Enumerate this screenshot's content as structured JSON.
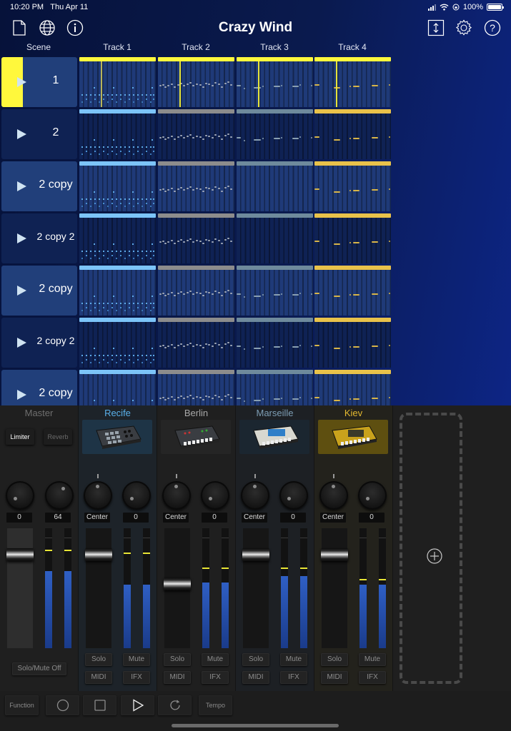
{
  "status_bar": {
    "time": "10:20 PM",
    "date": "Thu Apr 11",
    "battery": "100%"
  },
  "toolbar": {
    "title": "Crazy Wind",
    "left_icons": [
      "document-icon",
      "globe-icon",
      "info-icon"
    ],
    "right_icons": [
      "resize-vertical-icon",
      "gear-icon",
      "help-icon"
    ]
  },
  "grid": {
    "scene_header": "Scene",
    "tracks": [
      {
        "name": "Track 1",
        "color": "#7cc4f8"
      },
      {
        "name": "Track 2",
        "color": "#8c8c8c"
      },
      {
        "name": "Track 3",
        "color": "#6e8a9c"
      },
      {
        "name": "Track 4",
        "color": "#e9c24a"
      }
    ],
    "playing_color": "#fff83c",
    "scenes": [
      {
        "name": "1",
        "selected": true,
        "style": "light",
        "playing": true,
        "empty": []
      },
      {
        "name": "2",
        "selected": false,
        "style": "dark",
        "playing": false,
        "empty": []
      },
      {
        "name": "2 copy",
        "selected": false,
        "style": "light",
        "playing": false,
        "empty": [
          2
        ]
      },
      {
        "name": "2 copy 2",
        "selected": false,
        "style": "dark",
        "playing": false,
        "empty": [
          2
        ]
      },
      {
        "name": "2 copy",
        "selected": false,
        "style": "light",
        "playing": false,
        "empty": []
      },
      {
        "name": "2 copy 2",
        "selected": false,
        "style": "dark",
        "playing": false,
        "empty": []
      },
      {
        "name": "2 copy",
        "selected": false,
        "style": "light",
        "playing": false,
        "empty": []
      }
    ],
    "playhead_position": 0.28
  },
  "mixer": {
    "master": {
      "name": "Master",
      "limiter_label": "Limiter",
      "reverb_label": "Reverb",
      "knob_values": [
        "0",
        "64"
      ],
      "fader_level": 0.82,
      "meter_levels": [
        0.64,
        0.64
      ],
      "peak_levels": [
        0.82,
        0.82
      ],
      "solo_mute_off_label": "Solo/Mute Off"
    },
    "channels": [
      {
        "name": "Recife",
        "name_color": "#5ab0ea",
        "bg": "#1d2329",
        "img_bg": "#1e3446",
        "pan": "Center",
        "send": "0",
        "fader_level": 0.82,
        "meter_levels": [
          0.53,
          0.53
        ],
        "peak_levels": [
          0.8,
          0.8
        ]
      },
      {
        "name": "Berlin",
        "name_color": "#a8a8a8",
        "bg": "#1f1f1f",
        "img_bg": "#252525",
        "pan": "Center",
        "send": "0",
        "fader_level": 0.58,
        "meter_levels": [
          0.55,
          0.55
        ],
        "peak_levels": [
          0.67,
          0.67
        ]
      },
      {
        "name": "Marseille",
        "name_color": "#7d9db4",
        "bg": "#1d2024",
        "img_bg": "#1b2630",
        "pan": "Center",
        "send": "0",
        "fader_level": 0.82,
        "meter_levels": [
          0.6,
          0.6
        ],
        "peak_levels": [
          0.67,
          0.67
        ]
      },
      {
        "name": "Kiev",
        "name_color": "#e3b930",
        "bg": "#23221c",
        "img_bg": "#5e4f10",
        "pan": "Center",
        "send": "0",
        "fader_level": 0.82,
        "meter_levels": [
          0.53,
          0.53
        ],
        "peak_levels": [
          0.58,
          0.58
        ]
      }
    ],
    "solo_label": "Solo",
    "mute_label": "Mute",
    "midi_label": "MIDI",
    "ifx_label": "IFX",
    "add_track_icon": "plus-circle-icon"
  },
  "transport": {
    "function_label": "Function",
    "tempo_label": "Tempo",
    "buttons": [
      "record-icon",
      "stop-icon",
      "play-icon",
      "loop-icon"
    ]
  }
}
